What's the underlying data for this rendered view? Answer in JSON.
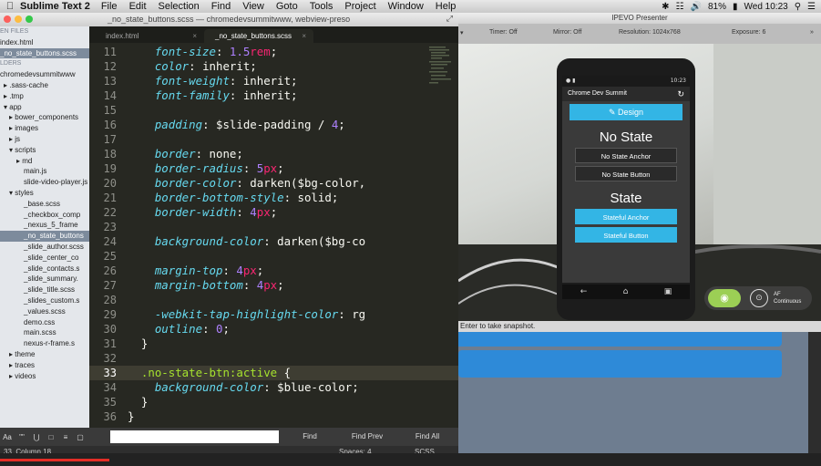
{
  "menubar": {
    "app_name": "Sublime Text 2",
    "items": [
      "File",
      "Edit",
      "Selection",
      "Find",
      "View",
      "Goto",
      "Tools",
      "Project",
      "Window",
      "Help"
    ],
    "battery": "81%",
    "clock": "Wed 10:23"
  },
  "editor": {
    "window_title": "_no_state_buttons.scss — chromedevsummitwww, webview-preso",
    "tabs": [
      {
        "label": "index.html",
        "active": false
      },
      {
        "label": "_no_state_buttons.scss",
        "active": true
      }
    ],
    "sidebar": [
      {
        "label": "EN FILES",
        "header": true,
        "indent": 0
      },
      {
        "label": "index.html",
        "indent": 0
      },
      {
        "label": "_no_state_buttons.scss",
        "indent": 0,
        "selected": true
      },
      {
        "label": "LDERS",
        "header": true,
        "indent": 0
      },
      {
        "label": "chromedevsummitwww",
        "indent": 0
      },
      {
        "label": "▸ .sass-cache",
        "indent": 4
      },
      {
        "label": "▸ .tmp",
        "indent": 4
      },
      {
        "label": "▾ app",
        "indent": 4
      },
      {
        "label": "▸ bower_components",
        "indent": 10
      },
      {
        "label": "▸ images",
        "indent": 10
      },
      {
        "label": "▸ js",
        "indent": 10
      },
      {
        "label": "▾ scripts",
        "indent": 10
      },
      {
        "label": "▸ md",
        "indent": 18
      },
      {
        "label": "main.js",
        "indent": 26
      },
      {
        "label": "slide-video-player.js",
        "indent": 26
      },
      {
        "label": "▾ styles",
        "indent": 10
      },
      {
        "label": "_base.scss",
        "indent": 26
      },
      {
        "label": "_checkbox_comp",
        "indent": 26
      },
      {
        "label": "_nexus_5_frame",
        "indent": 26
      },
      {
        "label": "_no_state_buttons",
        "indent": 26,
        "selected": true
      },
      {
        "label": "_slide_author.scss",
        "indent": 26
      },
      {
        "label": "_slide_center_co",
        "indent": 26
      },
      {
        "label": "_slide_contacts.s",
        "indent": 26
      },
      {
        "label": "_slide_summary.",
        "indent": 26
      },
      {
        "label": "_slide_title.scss",
        "indent": 26
      },
      {
        "label": "_slides_custom.s",
        "indent": 26
      },
      {
        "label": "_values.scss",
        "indent": 26
      },
      {
        "label": "demo.css",
        "indent": 26
      },
      {
        "label": "main.scss",
        "indent": 26
      },
      {
        "label": "nexus-r-frame.s",
        "indent": 26
      },
      {
        "label": "▸ theme",
        "indent": 10
      },
      {
        "label": "▸ traces",
        "indent": 10
      },
      {
        "label": "▸ videos",
        "indent": 10
      }
    ],
    "line_numbers": [
      "11",
      "12",
      "13",
      "14",
      "15",
      "16",
      "17",
      "18",
      "19",
      "20",
      "21",
      "22",
      "23",
      "24",
      "25",
      "26",
      "27",
      "28",
      "29",
      "30",
      "31",
      "32",
      "33",
      "34",
      "35",
      "36"
    ],
    "current_line": "33",
    "code": {
      "l11_prop": "font-size",
      "l11_num": "1.5",
      "l11_unit": "rem",
      "l12_prop": "color",
      "l12_val": "inherit",
      "l13_prop": "font-weight",
      "l13_val": "inherit",
      "l14_prop": "font-family",
      "l14_val": "inherit",
      "l16_prop": "padding",
      "l16_val": "$slide-padding / ",
      "l16_num": "4",
      "l18_prop": "border",
      "l18_val": "none",
      "l19_prop": "border-radius",
      "l19_num": "5",
      "l19_unit": "px",
      "l20_prop": "border-color",
      "l20_val": "darken($bg-color,",
      "l21_prop": "border-bottom-style",
      "l21_val": "solid",
      "l22_prop": "border-width",
      "l22_num": "4",
      "l22_unit": "px",
      "l24_prop": "background-color",
      "l24_val": "darken($bg-co",
      "l26_prop": "margin-top",
      "l26_num": "4",
      "l26_unit": "px",
      "l27_prop": "margin-bottom",
      "l27_num": "4",
      "l27_unit": "px",
      "l29_prop": "-webkit-tap-highlight-",
      "l29_prop2": "color",
      "l29_val": "rg",
      "l30_prop": "outline",
      "l30_num": "0",
      "l31": "}",
      "l33_sel": ".no-state-btn",
      "l33_pseudo": ":active",
      "l33_brace": " {",
      "l34_prop": "background-color",
      "l34_val": "$blue-color",
      "l35": "}",
      "l36": "}"
    },
    "findbar": {
      "options": [
        "Aa",
        "\"\"",
        "⋃",
        "□",
        "≡",
        "▢"
      ],
      "find": "Find",
      "find_prev": "Find Prev",
      "find_all": "Find All"
    },
    "statusbar": {
      "position": "33, Column 18",
      "spaces": "Spaces: 4",
      "syntax": "SCSS"
    }
  },
  "ipevo": {
    "title": "IPEVO Presenter",
    "toolbar": {
      "timer": "Timer: Off",
      "mirror": "Mirror: Off",
      "resolution": "Resolution: 1024x768",
      "exposure": "Exposure: 6"
    },
    "hint": "Enter to take snapshot.",
    "af_label": "AF",
    "af_mode": "Continuous",
    "phone": {
      "status_time": "10:23",
      "app_title": "Chrome Dev Summit",
      "design_label": "Design",
      "no_state_heading": "No State",
      "no_state_anchor": "No State Anchor",
      "no_state_button": "No State Button",
      "state_heading": "State",
      "stateful_anchor": "Stateful Anchor",
      "stateful_button": "Stateful Button"
    }
  },
  "colors": {
    "editor_bg": "#272822",
    "property": "#66d9ef",
    "number": "#ae81ff",
    "unit": "#f92672",
    "selector": "#a6e22e",
    "android_blue": "#33b5e5",
    "shutter_green": "#9ccf55"
  }
}
